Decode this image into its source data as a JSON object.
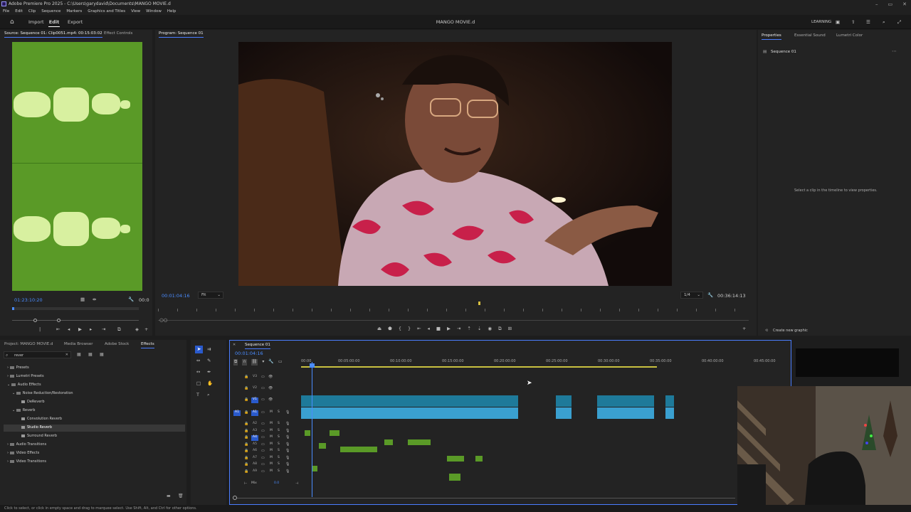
{
  "window": {
    "title": "Adobe Premiere Pro 2025 - C:\\Users\\garydavid\\Documents\\MANGO MOVIE.d",
    "controls": [
      "–",
      "▭",
      "✕"
    ]
  },
  "menu": [
    "File",
    "Edit",
    "Clip",
    "Sequence",
    "Markers",
    "Graphics and Titles",
    "View",
    "Window",
    "Help"
  ],
  "header": {
    "tabs": [
      "Import",
      "Edit",
      "Export"
    ],
    "project_title": "MANGO MOVIE.d",
    "workspace": "LEARNING"
  },
  "source": {
    "tab": "Source: Sequence 01: Clip0051.mp4: 00:15:03:02",
    "tab2": "Effect Controls",
    "timecode": "01:23:10:20",
    "end_tc": "00:0"
  },
  "program": {
    "tab": "Program: Sequence 01",
    "timecode": "00:01:04:16",
    "fit": "Fit",
    "quality": "1/4",
    "duration": "00:36:14:13"
  },
  "properties": {
    "tabs": [
      "Properties",
      "Essential Sound",
      "Lumetri Color"
    ],
    "sequence": "Sequence 01",
    "empty_msg": "Select a clip in the timeline to view properties.",
    "create_graphic": "Create new graphic"
  },
  "effects": {
    "tabs": [
      "Project: MANGO MOVIE.d",
      "Media Browser",
      "Adobe Stock",
      "Effects"
    ],
    "search": "rever",
    "tree": [
      "Presets",
      "Lumetri Presets",
      "Audio Effects",
      "Noise Reduction/Restoration",
      "DeReverb",
      "Reverb",
      "Convolution Reverb",
      "Studio Reverb",
      "Surround Reverb",
      "Audio Transitions",
      "Video Effects",
      "Video Transitions"
    ]
  },
  "timeline": {
    "tab": "Sequence 01",
    "timecode": "00:01:04:16",
    "ruler": [
      "00:00",
      "00:05:00:00",
      "00:10:00:00",
      "00:15:00:00",
      "00:20:00:00",
      "00:25:00:00",
      "00:30:00:00",
      "00:35:00:00",
      "00:40:00:00",
      "00:45:00:00"
    ],
    "video_tracks": [
      "V3",
      "V2",
      "V1"
    ],
    "audio_tracks": [
      "A1",
      "A2",
      "A3",
      "A4",
      "A5",
      "A6",
      "A7",
      "A8",
      "A9"
    ],
    "mix": "Mix",
    "mix_val": "0.0"
  },
  "status": "Click to select, or click in empty space and drag to marquee select. Use Shift, Alt, and Ctrl for other options."
}
